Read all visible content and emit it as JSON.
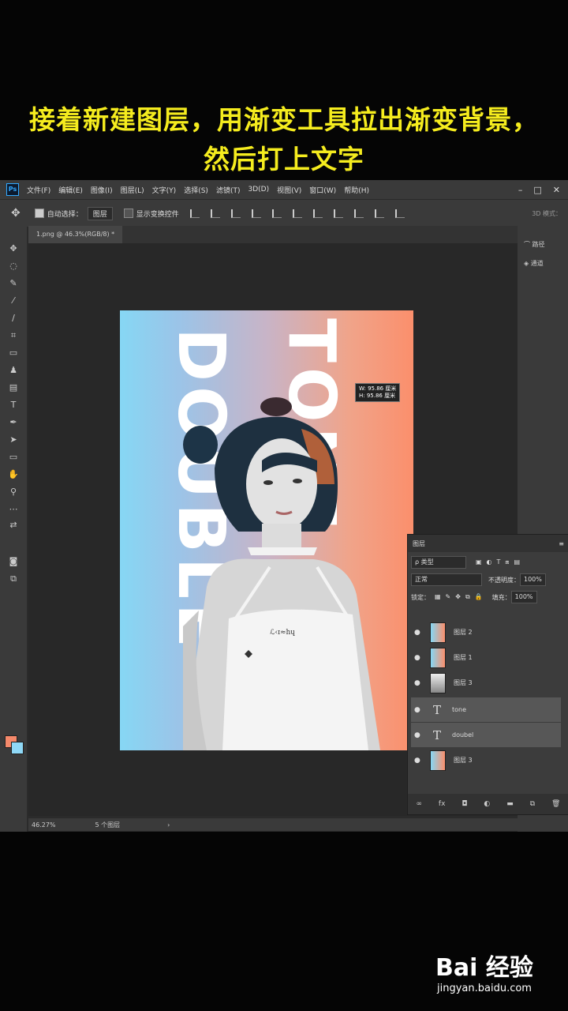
{
  "caption": {
    "line1": "接着新建图层，用渐变工具拉出渐变背景，",
    "line2": "然后打上文字"
  },
  "ps": {
    "logo": "Ps",
    "menu": [
      "文件(F)",
      "编辑(E)",
      "图像(I)",
      "图层(L)",
      "文字(Y)",
      "选择(S)",
      "滤镜(T)",
      "3D(D)",
      "视图(V)",
      "窗口(W)",
      "帮助(H)"
    ],
    "window_controls": [
      "–",
      "□",
      "✕"
    ],
    "options": {
      "auto_select_label": "自动选择：",
      "auto_select_value": "图层",
      "show_transform_label": "显示变换控件",
      "mode_3d": "3D 模式："
    },
    "doc_tab": "1.png @ 46.3%(RGB/8) *",
    "status": {
      "zoom": "46.27%",
      "info": "5 个图层"
    },
    "right_dock": [
      "路径",
      "通道"
    ],
    "artboard": {
      "text_tone": "TONE",
      "text_double": "DOUBLE",
      "tooltip": "W: 95.86 厘米\nH: 95.86 厘米",
      "shirt_text": "ℒ‹ɪ≈hɥ"
    },
    "layers_panel": {
      "title": "图层",
      "filter_kind": "ρ 类型",
      "blend_mode": "正常",
      "opacity_label": "不透明度：",
      "opacity_value": "100%",
      "lock_label": "锁定：",
      "fill_label": "填充：",
      "fill_value": "100%",
      "layers": [
        {
          "name": "图层 2",
          "type": "grad",
          "highlight": false
        },
        {
          "name": "图层 1",
          "type": "grad",
          "highlight": false
        },
        {
          "name": "图层 3",
          "type": "photo",
          "highlight": false
        },
        {
          "name": "tone",
          "type": "text",
          "highlight": true
        },
        {
          "name": "doubel",
          "type": "text",
          "highlight": true
        },
        {
          "name": "图层 3",
          "type": "grad",
          "highlight": false
        }
      ],
      "bottom_icons": [
        "link-icon",
        "fx-icon",
        "mask-icon",
        "adjustment-icon",
        "folder-icon",
        "new-layer-icon",
        "trash-icon"
      ]
    }
  },
  "watermark": {
    "logo": "Bai  经验",
    "url": "jingyan.baidu.com"
  },
  "colors": {
    "caption": "#f5ec1e",
    "gradient_left": "#86d7f4",
    "gradient_right": "#fb8f6c",
    "foreground": "#f4896b",
    "background": "#8fd8f6"
  }
}
